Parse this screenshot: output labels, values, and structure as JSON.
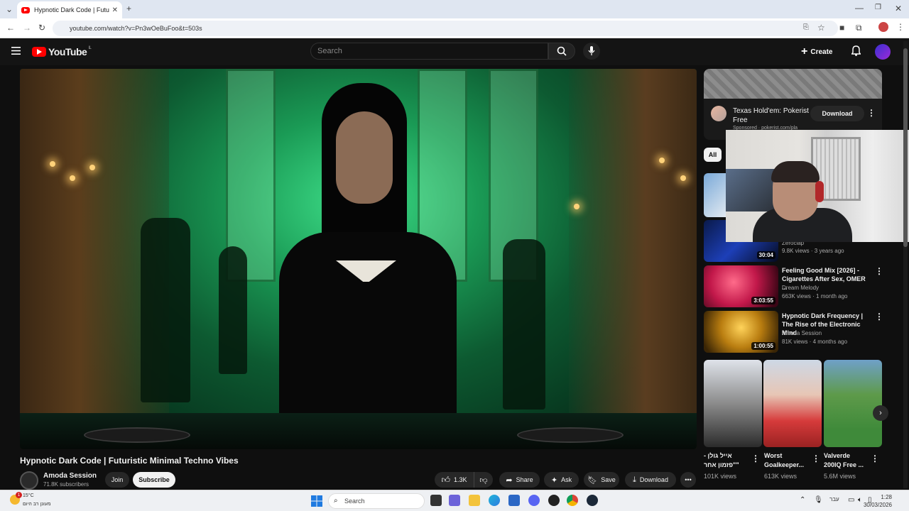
{
  "browser": {
    "tab_title": "Hypnotic Dark Code | Futuristic",
    "url": "youtube.com/watch?v=Pn3wOeBuFoo&t=503s"
  },
  "youtube": {
    "logo_text": "YouTube",
    "country_code": "IL",
    "search_placeholder": "Search",
    "create_label": "Create"
  },
  "video": {
    "title": "Hypnotic Dark Code | Futuristic Minimal Techno Vibes",
    "channel": "Amoda Session",
    "subscribers": "71.8K subscribers",
    "join_label": "Join",
    "subscribe_label": "Subscribe",
    "likes": "1.3K",
    "share_label": "Share",
    "ask_label": "Ask",
    "save_label": "Save",
    "download_label": "Download"
  },
  "ad": {
    "title": "Texas Hold'em: Pokerist Free",
    "sponsored": "Sponsored · pokerist.com/pla",
    "button": "Download"
  },
  "chips": {
    "all": "All"
  },
  "recommendations": [
    {
      "title": "",
      "channel": "Zeroclap",
      "meta": "9.8K views · 3 years ago",
      "duration": "30:04"
    },
    {
      "title": "Feeling Good Mix [2026] - Cigarettes After Sex, OMER ...",
      "channel": "Dream Melody",
      "meta": "663K views · 1 month ago",
      "duration": "3:03:55"
    },
    {
      "title": "Hypnotic Dark Frequency | The Rise of the Electronic Mind",
      "channel": "Amoda Session",
      "meta": "81K views · 4 months ago",
      "duration": "1:00:55"
    }
  ],
  "shorts": [
    {
      "title": "אייל גולן - \"פזמון אחר\"",
      "views": "101K views"
    },
    {
      "title": "Worst Goalkeeper...",
      "views": "613K views"
    },
    {
      "title": "Valverde 200IQ Free ...",
      "views": "5.6M views"
    }
  ],
  "taskbar": {
    "temperature": "15°C",
    "weather_badge": "1",
    "condition": "מעונן רב היום",
    "search_label": "Search",
    "language": "עבר",
    "time": "1:28",
    "date": "30/03/2026"
  },
  "colors": {
    "youtube_red": "#ff0000",
    "background": "#0f0f0f",
    "video_green": "#1a9a55"
  }
}
